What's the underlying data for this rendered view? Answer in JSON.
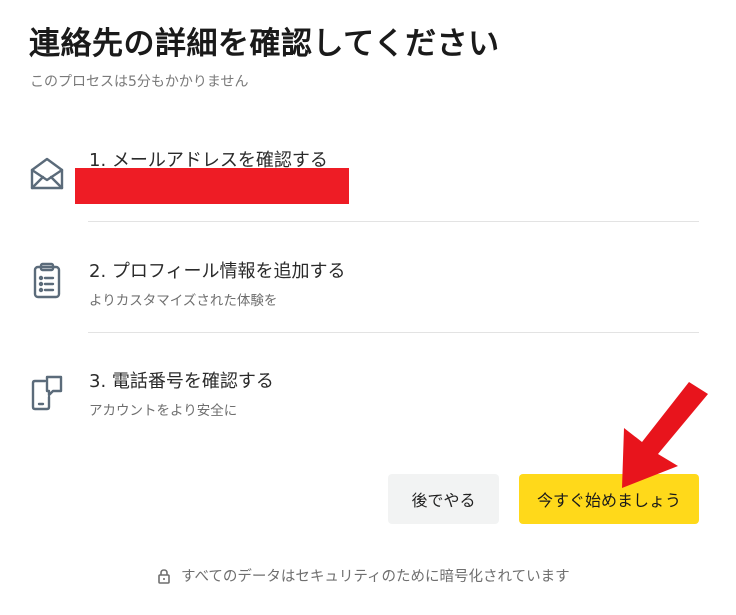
{
  "header": {
    "title": "連絡先の詳細を確認してください",
    "subtitle": "このプロセスは5分もかかりません"
  },
  "steps": [
    {
      "number_title": "1. メールアドレスを確認する",
      "icon": "envelope-icon",
      "description": ""
    },
    {
      "number_title": "2. プロフィール情報を追加する",
      "icon": "clipboard-icon",
      "description": "よりカスタマイズされた体験を"
    },
    {
      "number_title": "3. 電話番号を確認する",
      "icon": "phone-chat-icon",
      "description": "アカウントをより安全に"
    }
  ],
  "actions": {
    "later_label": "後でやる",
    "start_label": "今すぐ始めましょう"
  },
  "footer": {
    "icon": "lock-icon",
    "text": "すべてのデータはセキュリティのために暗号化されています"
  },
  "colors": {
    "primary_button": "#ffd91a",
    "secondary_button": "#f2f3f3",
    "icon_color": "#5b6b7a",
    "redaction": "#ee1c25",
    "annotation_arrow": "#e8141c"
  }
}
